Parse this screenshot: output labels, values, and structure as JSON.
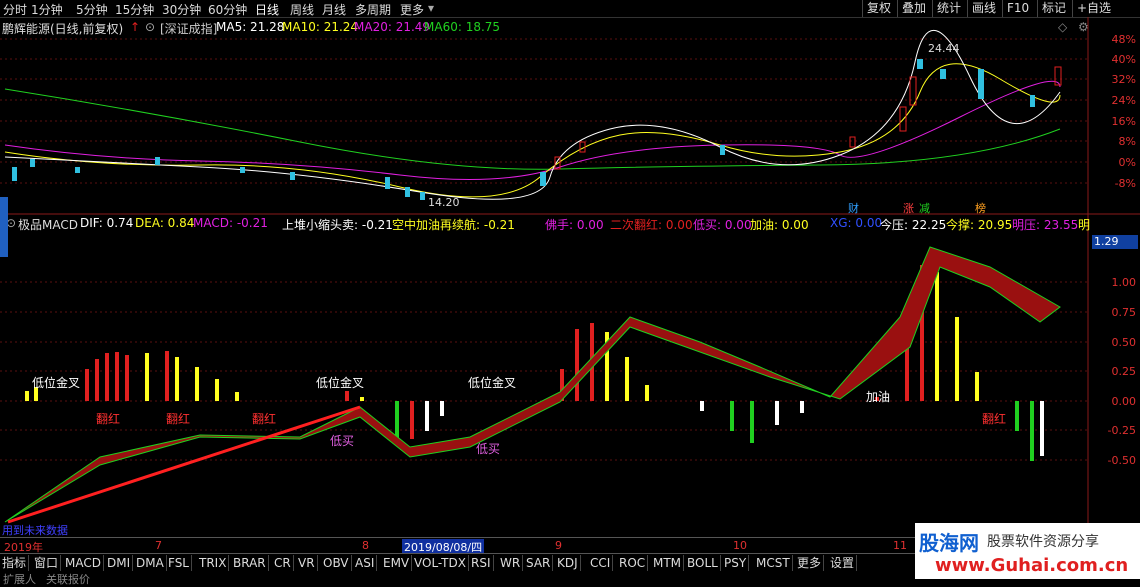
{
  "topbar": {
    "periods": [
      "分时",
      "1分钟",
      "5分钟",
      "15分钟",
      "30分钟",
      "60分钟",
      "日线",
      "周线",
      "月线",
      "多周期",
      "更多"
    ],
    "active": "日线",
    "right_buttons": [
      "复权",
      "叠加",
      "统计",
      "画线",
      "F10",
      "标记",
      "+自选"
    ]
  },
  "stock": {
    "name": "鹏辉能源(日线,前复权)",
    "index_label": "[深证成指]",
    "ma5": "MA5: 21.28",
    "ma10": "MA10: 21.24",
    "ma20": "MA20: 21.49",
    "ma60": "MA60: 18.75"
  },
  "price_axis": [
    "48%",
    "40%",
    "32%",
    "24%",
    "16%",
    "8%",
    "0%",
    "-8%"
  ],
  "price_annotations": {
    "high": "24.44",
    "low": "14.20"
  },
  "markers": [
    "财",
    "涨",
    "减",
    "榜"
  ],
  "indicator": {
    "name": "极品MACD",
    "dif": "DIF: 0.74",
    "dea": "DEA: 0.84",
    "macd": "MACD: -0.21",
    "t1": "上堆小缩头卖: -0.21",
    "t2": "空中加油再续航: -0.21",
    "t3": "佛手: 0.00",
    "t4": "二次翻红: 0.00",
    "t5": "低买: 0.00",
    "t6": "加油: 0.00",
    "t7": "XG: 0.00",
    "t8": "今压: 22.25",
    "t9": "今撑: 20.95",
    "t10": "明压: 23.55",
    "t11": "明"
  },
  "indicator_axis": [
    "1.29",
    "1.00",
    "0.75",
    "0.50",
    "0.25",
    "0.00",
    "-0.25",
    "-0.50"
  ],
  "labels": {
    "golden_cross": "低位金叉",
    "turn_red": "翻红",
    "low_buy": "低买",
    "refuel": "加油",
    "warning": "用到未来数据"
  },
  "dates": {
    "year": "2019年",
    "m7": "7",
    "m8": "8",
    "cursor": "2019/08/08/四",
    "m9": "9",
    "m10": "10",
    "m11": "11"
  },
  "tabs": [
    "指标",
    "窗口",
    "MACD",
    "DMI",
    "DMA",
    "FSL",
    "TRIX",
    "BRAR",
    "CR",
    "VR",
    "OBV",
    "ASI",
    "EMV",
    "VOL-TDX",
    "RSI",
    "WR",
    "SAR",
    "KDJ",
    "CCI",
    "ROC",
    "MTM",
    "BOLL",
    "PSY",
    "MCST",
    "更多",
    "设置"
  ],
  "bottom_row": [
    "扩展​人",
    "关联报价"
  ],
  "watermark": {
    "title": "股海网",
    "subtitle": "股票软件资源分享",
    "url": "www.Guhai.com.cn"
  },
  "colors": {
    "up": "#e02020",
    "down": "#30c0e0",
    "yellow": "#ffff20",
    "green": "#20d020",
    "magenta": "#e020e0",
    "axis": "#e03030"
  }
}
